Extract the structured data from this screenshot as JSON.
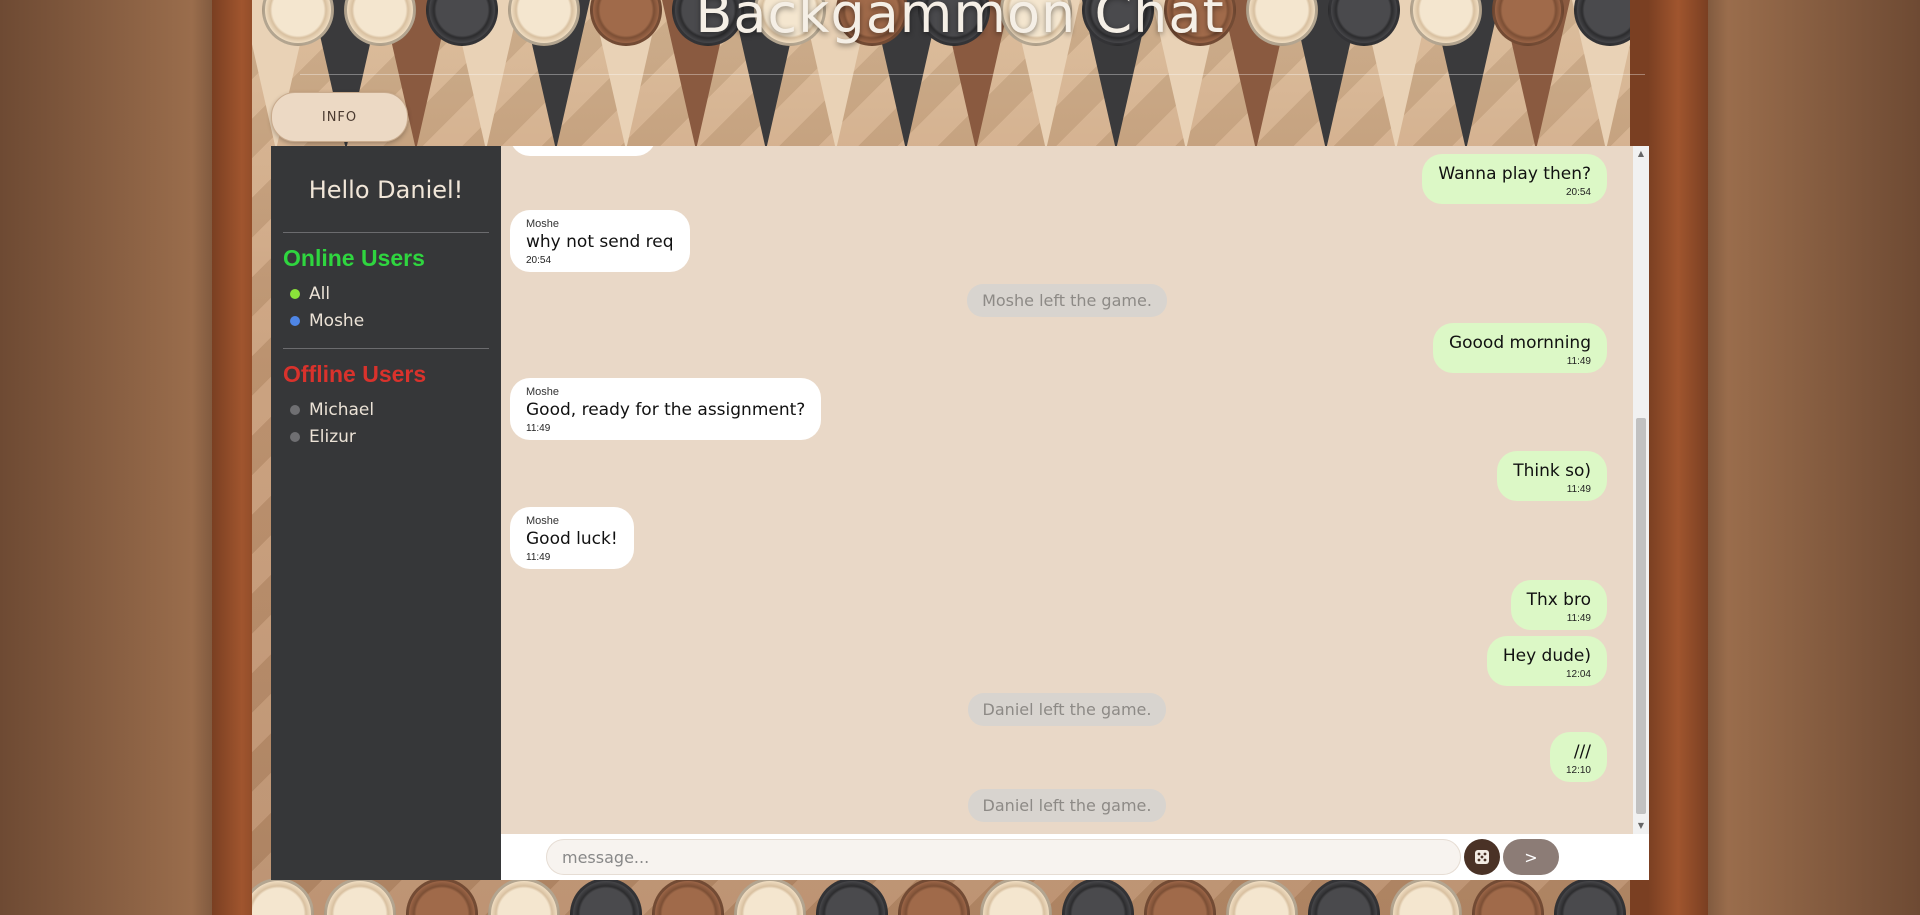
{
  "header": {
    "title": "Backgammon Chat",
    "info_button": "INFO"
  },
  "sidebar": {
    "greeting": "Hello Daniel!",
    "online_title": "Online Users",
    "online_users": [
      {
        "name": "All",
        "color": "#8be23a"
      },
      {
        "name": "Moshe",
        "color": "#4f86e6"
      }
    ],
    "offline_title": "Offline Users",
    "offline_users": [
      {
        "name": "Michael",
        "color": "#6f6f72"
      },
      {
        "name": "Elizur",
        "color": "#6f6f72"
      }
    ]
  },
  "messages": [
    {
      "type": "out",
      "text": "Wanna play then?",
      "time": "20:54"
    },
    {
      "type": "in",
      "author": "Moshe",
      "text": "why not send req",
      "time": "20:54"
    },
    {
      "type": "system",
      "text": "Moshe left the game."
    },
    {
      "type": "out",
      "text": "Goood mornning",
      "time": "11:49"
    },
    {
      "type": "in",
      "author": "Moshe",
      "text": "Good, ready for the assignment?",
      "time": "11:49"
    },
    {
      "type": "out",
      "text": "Think so)",
      "time": "11:49"
    },
    {
      "type": "in",
      "author": "Moshe",
      "text": "Good luck!",
      "time": "11:49"
    },
    {
      "type": "out",
      "text": "Thx bro",
      "time": "11:49"
    },
    {
      "type": "out",
      "text": "Hey dude)",
      "time": "12:04"
    },
    {
      "type": "system",
      "text": "Daniel left the game."
    },
    {
      "type": "out",
      "text": "///",
      "time": "12:10"
    },
    {
      "type": "system",
      "text": "Daniel left the game."
    }
  ],
  "composer": {
    "placeholder": "message...",
    "send_label": ">"
  },
  "scrollbar": {
    "up": "▲",
    "down": "▼"
  },
  "colors": {
    "chat_bg": "#e9d8c7",
    "outgoing": "#dcf8c6",
    "incoming": "#ffffff",
    "sidebar": "#363739",
    "online": "#2fd53f",
    "offline": "#d9322c"
  }
}
